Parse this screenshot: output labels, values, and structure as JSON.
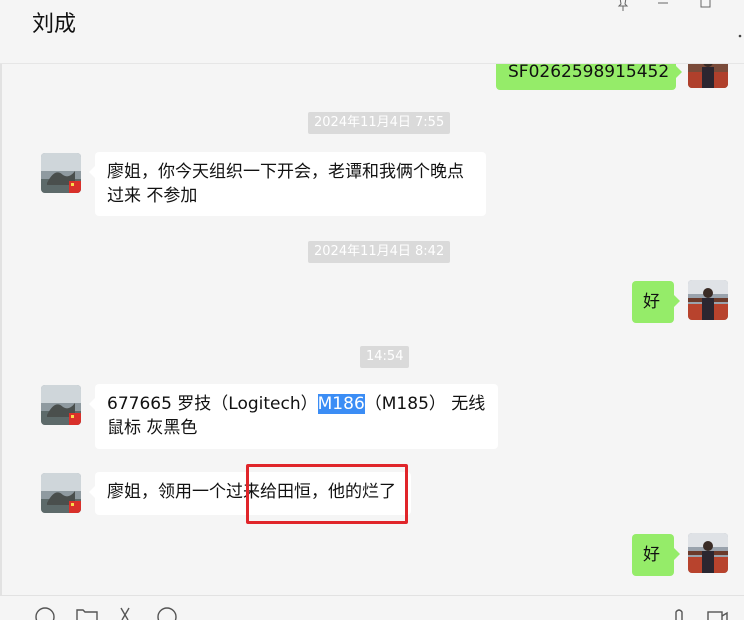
{
  "chat": {
    "title": "刘成"
  },
  "window_controls": [
    "pin-icon",
    "minimize-icon",
    "maximize-icon",
    "more-icon"
  ],
  "messages": [
    {
      "type": "outgoing",
      "text": "SF0262598915452"
    },
    {
      "type": "time",
      "text": "2024年11月4日 7:55"
    },
    {
      "type": "incoming",
      "text_line1": "廖姐，你今天组织一下开会，老谭和我俩个晚点",
      "text_line2": "过来 不参加"
    },
    {
      "type": "time",
      "text": "2024年11月4日 8:42"
    },
    {
      "type": "outgoing",
      "text": "好"
    },
    {
      "type": "time",
      "text": "14:54"
    },
    {
      "type": "incoming",
      "text_prefix": "677665 罗技（Logitech）",
      "text_highlight": "M186",
      "text_suffix": "（M185） 无线",
      "text_line2": "鼠标 灰黑色"
    },
    {
      "type": "incoming",
      "text": "廖姐，领用一个过来给田恒，他的烂了"
    },
    {
      "type": "outgoing",
      "text": "好"
    }
  ],
  "toolbar": {
    "icons": [
      "emoji-icon",
      "folder-icon",
      "scissors-icon",
      "chat-history-icon",
      "voice-call-icon",
      "video-call-icon"
    ]
  },
  "colors": {
    "background": "#f5f5f5",
    "incoming_bubble": "#ffffff",
    "outgoing_bubble": "#95ec69",
    "time_badge": "#dadada",
    "selection_highlight": "#3b8df5",
    "annotation_box": "#e0252a"
  }
}
